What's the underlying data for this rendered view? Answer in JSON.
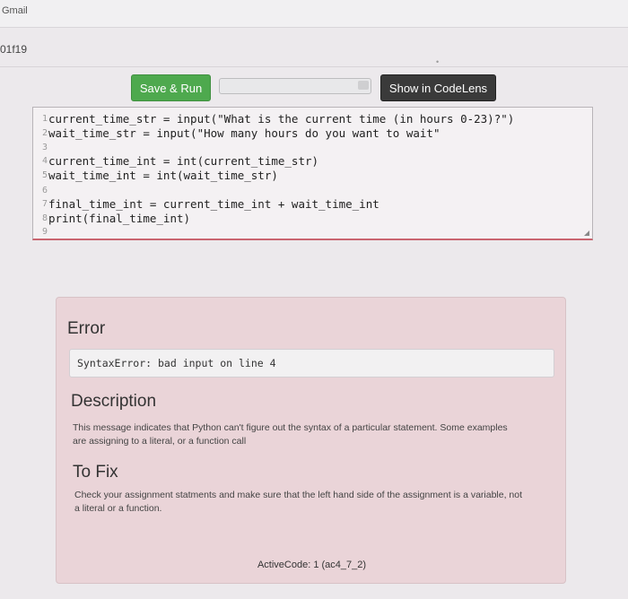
{
  "browser": {
    "tab_label": "Gmail"
  },
  "page": {
    "id_label": "01f19"
  },
  "toolbar": {
    "save_run_label": "Save & Run",
    "show_codelens_label": "Show in CodeLens"
  },
  "colors": {
    "save_button": "#4ea94e",
    "codelens_button": "#3a3a3a",
    "error_panel": "#ead4d8",
    "editor_border_accent": "#c96570"
  },
  "editor": {
    "lines": [
      {
        "num": "1",
        "code": "current_time_str = input(\"What is the current time (in hours 0-23)?\")"
      },
      {
        "num": "2",
        "code": "wait_time_str = input(\"How many hours do you want to wait\""
      },
      {
        "num": "3",
        "code": ""
      },
      {
        "num": "4",
        "code": "current_time_int = int(current_time_str)"
      },
      {
        "num": "5",
        "code": "wait_time_int = int(wait_time_str)"
      },
      {
        "num": "6",
        "code": ""
      },
      {
        "num": "7",
        "code": "final_time_int = current_time_int + wait_time_int"
      },
      {
        "num": "8",
        "code": "print(final_time_int)"
      },
      {
        "num": "9",
        "code": ""
      }
    ]
  },
  "error": {
    "title": "Error",
    "message": "SyntaxError: bad input on line 4",
    "description_title": "Description",
    "description_text": "This message indicates that Python can't figure out the syntax of a particular statement. Some examples are assigning to a literal, or a function call",
    "fix_title": "To Fix",
    "fix_text": "Check your assignment statments and make sure that the left hand side of the assignment is a variable, not a literal or a function.",
    "activecode_label": "ActiveCode: 1 (ac4_7_2)"
  }
}
